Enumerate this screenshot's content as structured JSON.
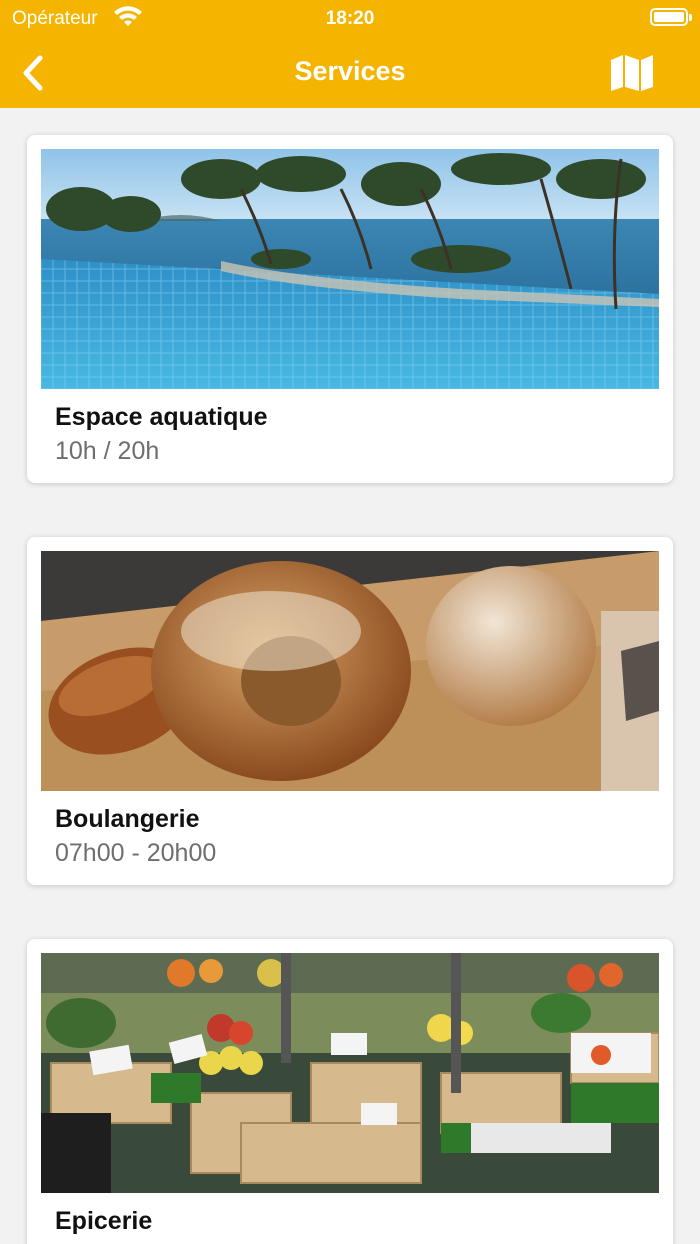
{
  "status_bar": {
    "carrier": "Opérateur",
    "time": "18:20"
  },
  "nav": {
    "title": "Services",
    "back_icon": "chevron-left-icon",
    "map_icon": "map-icon"
  },
  "colors": {
    "accent": "#f4b400",
    "card_background": "#ffffff",
    "page_background": "#f2f2f2",
    "subtitle": "#6e6e6e"
  },
  "services": [
    {
      "title": "Espace aquatique",
      "hours": "10h / 20h"
    },
    {
      "title": "Boulangerie",
      "hours": "07h00 - 20h00"
    },
    {
      "title": "Epicerie",
      "hours": ""
    }
  ]
}
